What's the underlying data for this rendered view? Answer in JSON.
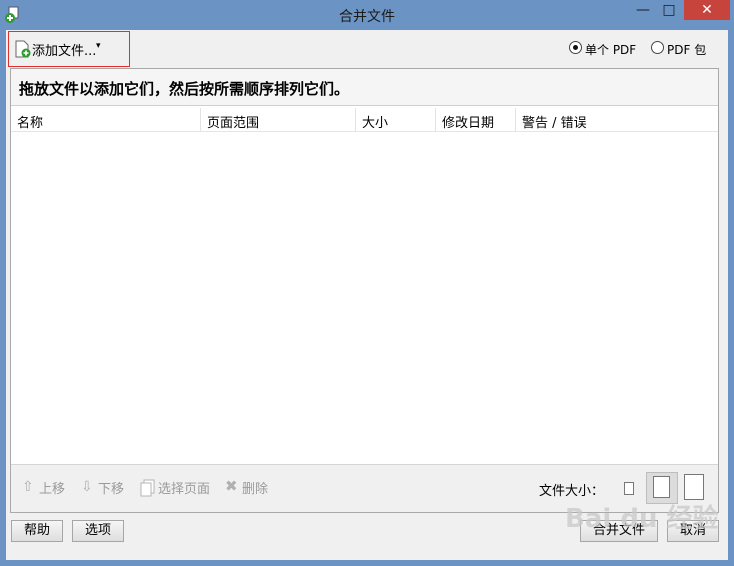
{
  "window": {
    "title": "合并文件",
    "min_glyph": "—",
    "max_glyph": "□",
    "close_glyph": "✕",
    "accent": "#6b93c4"
  },
  "toolbar": {
    "add_files_label": "添加文件...",
    "add_files_caret": "▾",
    "output_options": [
      {
        "label": "单个 PDF",
        "selected": true
      },
      {
        "label": "PDF 包",
        "selected": false
      }
    ]
  },
  "panel": {
    "hint": "拖放文件以添加它们，然后按所需顺序排列它们。",
    "columns": [
      "名称",
      "页面范围",
      "大小",
      "修改日期",
      "警告 / 错误"
    ],
    "rows": []
  },
  "tools": {
    "move_up": "上移",
    "move_down": "下移",
    "choose_pages": "选择页面",
    "delete": "删除",
    "file_size_label": "文件大小："
  },
  "buttons": {
    "help": "帮助",
    "options": "选项",
    "merge": "合并文件",
    "cancel": "取消"
  },
  "watermark": "Bai du 经验"
}
